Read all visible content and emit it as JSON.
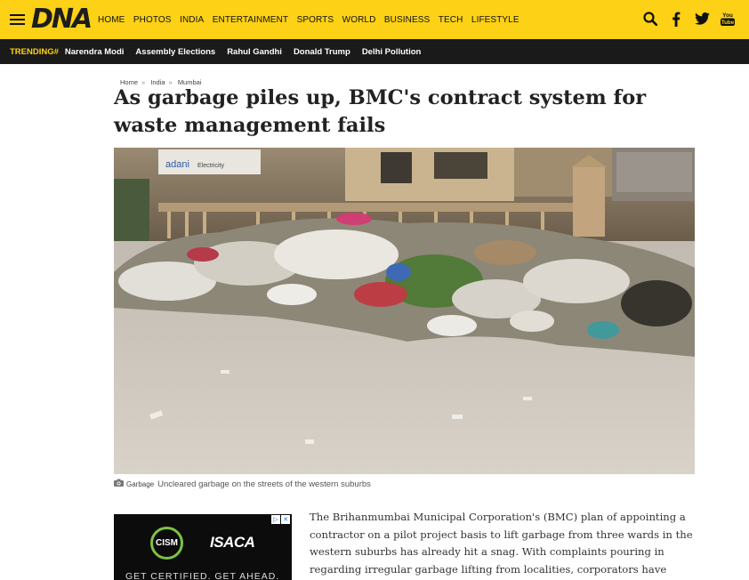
{
  "header": {
    "logo": "DNA",
    "nav": [
      "HOME",
      "PHOTOS",
      "INDIA",
      "ENTERTAINMENT",
      "SPORTS",
      "WORLD",
      "BUSINESS",
      "TECH",
      "LIFESTYLE"
    ],
    "icons": [
      "search-icon",
      "facebook-icon",
      "twitter-icon",
      "youtube-icon"
    ],
    "youtube_label": "You Tube",
    "brand_color": "#fcd116"
  },
  "trending": {
    "label": "TRENDING#",
    "items": [
      "Narendra Modi",
      "Assembly Elections",
      "Rahul Gandhi",
      "Donald Trump",
      "Delhi Pollution"
    ]
  },
  "breadcrumb": [
    "Home",
    "India",
    "Mumbai"
  ],
  "article": {
    "headline": "As garbage piles up, BMC's contract system for waste management fails",
    "photo_signs": [
      "adani",
      "Electricity"
    ],
    "caption_credit": "Garbage",
    "caption": "Uncleared garbage on the streets of the western suburbs",
    "body": "The Brihanmumbai Municipal Corporation's (BMC) plan of appointing a contractor on a pilot project basis to lift garbage from three wards in the western suburbs has already hit a snag. With complaints pouring in regarding irregular garbage lifting from localities, corporators have begun"
  },
  "ad": {
    "logo_a": "CISM",
    "logo_b": "ISACA",
    "tagline": "GET CERTIFIED. GET AHEAD.",
    "choices_icon": "adchoices-icon",
    "close_symbol": "✕"
  }
}
